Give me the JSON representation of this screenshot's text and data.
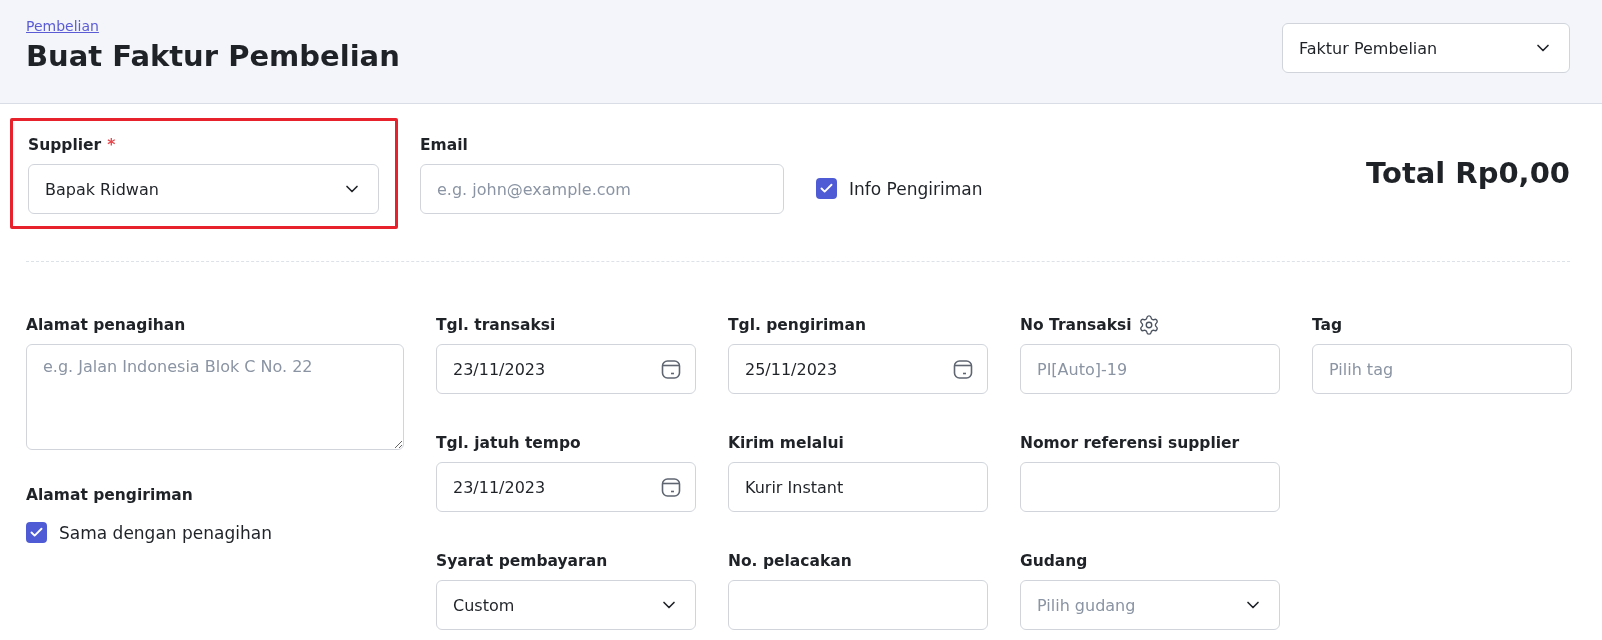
{
  "header": {
    "breadcrumb": "Pembelian",
    "title": "Buat Faktur Pembelian",
    "doc_type": {
      "value": "Faktur Pembelian"
    }
  },
  "top": {
    "supplier": {
      "label": "Supplier",
      "required_mark": "*",
      "highlighted": true,
      "value": "Bapak Ridwan"
    },
    "email": {
      "label": "Email",
      "placeholder": "e.g. john@example.com"
    },
    "info_pengiriman": {
      "label": "Info Pengiriman",
      "checked": true
    },
    "total": "Total Rp0,00"
  },
  "billing_address": {
    "label": "Alamat penagihan",
    "placeholder": "e.g. Jalan Indonesia Blok C No. 22"
  },
  "shipping_address": {
    "label": "Alamat pengiriman",
    "same_as_billing": {
      "label": "Sama dengan penagihan",
      "checked": true
    }
  },
  "columns": [
    [
      {
        "label": "Tgl. transaksi",
        "kind": "date",
        "value": "23/11/2023"
      },
      {
        "label": "Tgl. jatuh tempo",
        "kind": "date",
        "value": "23/11/2023"
      },
      {
        "label": "Syarat pembayaran",
        "kind": "select",
        "value": "Custom"
      }
    ],
    [
      {
        "label": "Tgl. pengiriman",
        "kind": "date",
        "value": "25/11/2023"
      },
      {
        "label": "Kirim melalui",
        "kind": "text",
        "value": "Kurir Instant"
      },
      {
        "label": "No. pelacakan",
        "kind": "text"
      }
    ],
    [
      {
        "label": "No Transaksi",
        "kind": "text",
        "settings": true,
        "placeholder": "PI[Auto]-19"
      },
      {
        "label": "Nomor referensi supplier",
        "kind": "text"
      },
      {
        "label": "Gudang",
        "kind": "select",
        "placeholder": "Pilih gudang"
      }
    ],
    [
      {
        "label": "Tag",
        "kind": "text",
        "placeholder": "Pilih tag"
      }
    ]
  ]
}
